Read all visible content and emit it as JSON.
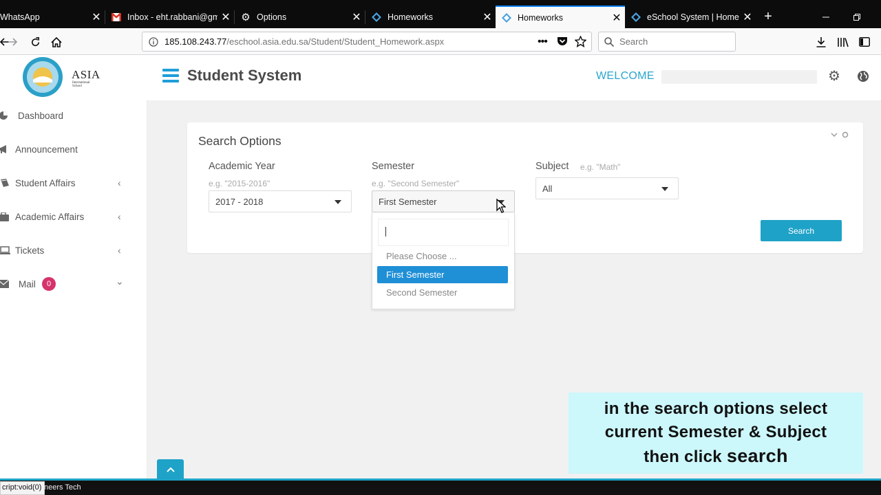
{
  "browser": {
    "tabs": [
      {
        "title": "WhatsApp",
        "icon": "whatsapp-icon"
      },
      {
        "title": "Inbox - eht.rabbani@gm",
        "icon": "gmail-icon"
      },
      {
        "title": "Options",
        "icon": "gear-icon"
      },
      {
        "title": "Homeworks",
        "icon": "diamond-icon"
      },
      {
        "title": "Homeworks",
        "icon": "diamond-icon",
        "active": true
      },
      {
        "title": "eSchool System | Home",
        "icon": "diamond-icon"
      }
    ],
    "url_host": "185.108.243.77",
    "url_path": "/eschool.asia.edu.sa/Student/Student_Homework.aspx",
    "search_placeholder": "Search",
    "accent": "#0a84ff"
  },
  "app": {
    "logo_text": "ASIA",
    "logo_subtext": "International School",
    "title": "Student System",
    "welcome": "WELCOME",
    "accent": "#1fa2c7"
  },
  "sidebar": {
    "items": [
      {
        "label": "Dashboard",
        "icon": "pie-chart-icon"
      },
      {
        "label": "Announcement",
        "icon": "bullhorn-icon"
      },
      {
        "label": "Student Affairs",
        "icon": "book-icon",
        "caret": "‹"
      },
      {
        "label": "Academic Affairs",
        "icon": "briefcase-icon",
        "caret": "‹"
      },
      {
        "label": "Tickets",
        "icon": "laptop-icon",
        "caret": "‹"
      },
      {
        "label": "Mail",
        "icon": "envelope-icon",
        "badge": "0",
        "caret": "⌄"
      }
    ]
  },
  "search_panel": {
    "title": "Search Options",
    "academic_year": {
      "label": "Academic Year",
      "hint": "e.g. \"2015-2016\"",
      "value": "2017 - 2018"
    },
    "semester": {
      "label": "Semester",
      "hint": "e.g. \"Second Semester\"",
      "value": "First Semester",
      "options": [
        "Please Choose ...",
        "First Semester",
        "Second Semester"
      ],
      "selected": "First Semester"
    },
    "subject": {
      "label": "Subject",
      "hint": "e.g. \"Math\"",
      "value": "All"
    },
    "search_button": "Search"
  },
  "caption": {
    "line1": "in the search options select",
    "line2": "current Semester & Subject",
    "line3_prefix": "then click ",
    "line3_word": "search"
  },
  "status": {
    "link_preview": "cript:void(0)",
    "footer": "neers Tech"
  }
}
